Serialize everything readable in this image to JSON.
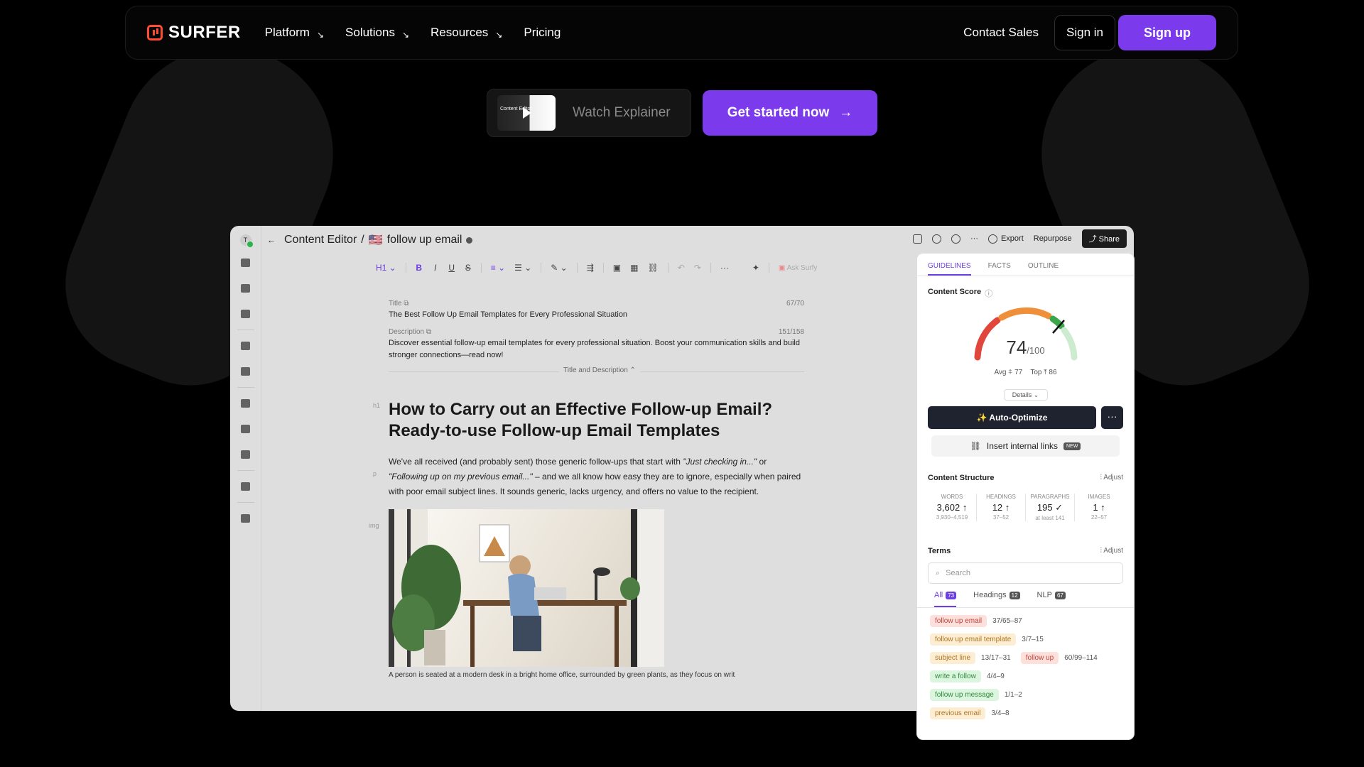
{
  "nav": {
    "logo": "SURFER",
    "items": [
      {
        "label": "Platform",
        "arrow": "↘"
      },
      {
        "label": "Solutions",
        "arrow": "↘"
      },
      {
        "label": "Resources",
        "arrow": "↘"
      },
      {
        "label": "Pricing",
        "arrow": ""
      }
    ],
    "contact": "Contact Sales",
    "signin": "Sign in",
    "signup": "Sign up"
  },
  "hero": {
    "watch_label": "Watch Explainer",
    "thumb_text": "Content Editor",
    "cta": "Get started now",
    "cta_arrow": "→"
  },
  "editor": {
    "avatar": "T",
    "breadcrumb_root": "Content Editor",
    "breadcrumb_sep": "/",
    "flag": "🇺🇸",
    "doc_name": "follow up email",
    "actions": {
      "export": "Export",
      "repurpose": "Repurpose",
      "share": "Share",
      "more": "···"
    },
    "toolbar": {
      "heading": "H1",
      "bold": "B",
      "italic": "I",
      "underline": "U",
      "strike": "S",
      "more": "···",
      "ask": "Ask Surfy"
    },
    "title_label": "Title",
    "title_count": "67/70",
    "title_text": "The Best Follow Up Email Templates for Every Professional Situation",
    "desc_label": "Description",
    "desc_count": "151/158",
    "desc_text": "Discover essential follow-up email templates for every professional situation. Boost your communication skills and build stronger connections—read now!",
    "collapse_label": "Title and Description ⌃",
    "h1_tag": "h1",
    "h1": "How to Carry out an Effective Follow-up Email? Ready-to-use Follow-up Email Templates",
    "p_tag": "p",
    "paragraph_1": "We've all received (and probably sent) those generic follow-ups that start with ",
    "paragraph_quote1": "\"Just checking in...\"",
    "paragraph_2": " or ",
    "paragraph_quote2": "\"Following up on my previous email...\"",
    "paragraph_3": " – and we all know how easy they are to ignore, especially when paired with poor email subject lines. It sounds generic, lacks urgency, and offers no value to the recipient.",
    "img_tag": "img",
    "caption": "A person is seated at a modern desk in a bright home office, surrounded by green plants, as they focus on writ"
  },
  "panel": {
    "tabs": [
      "GUIDELINES",
      "FACTS",
      "OUTLINE"
    ],
    "content_score_label": "Content Score",
    "score": "74",
    "score_max": "/100",
    "avg": "Avg",
    "avg_val": "77",
    "top": "Top",
    "top_val": "86",
    "details": "Details ⌄",
    "auto_optimize": "✨ Auto-Optimize",
    "more": "···",
    "internal_links": "Insert internal links",
    "new_badge": "NEW",
    "structure_label": "Content Structure",
    "adjust": "Adjust",
    "stats": [
      {
        "key": "WORDS",
        "value": "3,602 ↑",
        "range": "3,930–4,519"
      },
      {
        "key": "HEADINGS",
        "value": "12 ↑",
        "range": "37–52"
      },
      {
        "key": "PARAGRAPHS",
        "value": "195 ✓",
        "range": "at least 141"
      },
      {
        "key": "IMAGES",
        "value": "1 ↑",
        "range": "22–57"
      }
    ],
    "terms_label": "Terms",
    "search_placeholder": "Search",
    "term_tabs": [
      {
        "label": "All",
        "count": "73"
      },
      {
        "label": "Headings",
        "count": "12"
      },
      {
        "label": "NLP",
        "count": "67"
      }
    ],
    "terms": [
      {
        "term": "follow up email",
        "count": "37/65–87",
        "color": "#fde0dc"
      },
      {
        "term": "follow up email template",
        "count": "3/7–15",
        "color": "#fdeed3"
      },
      {
        "term": "subject line",
        "count": "13/17–31",
        "color": "#fdeed3"
      },
      {
        "term": "follow up",
        "count": "60/99–114",
        "color": "#fde0dc"
      },
      {
        "term": "write a follow",
        "count": "4/4–9",
        "color": "#dcf5df"
      },
      {
        "term": "follow up message",
        "count": "1/1–2",
        "color": "#dcf5df"
      },
      {
        "term": "previous email",
        "count": "3/4–8",
        "color": "#fdeed3"
      }
    ]
  },
  "colors": {
    "brand": "#7c3aed",
    "logo": "#ff4b36",
    "active_tab": "#6d3ee0"
  }
}
